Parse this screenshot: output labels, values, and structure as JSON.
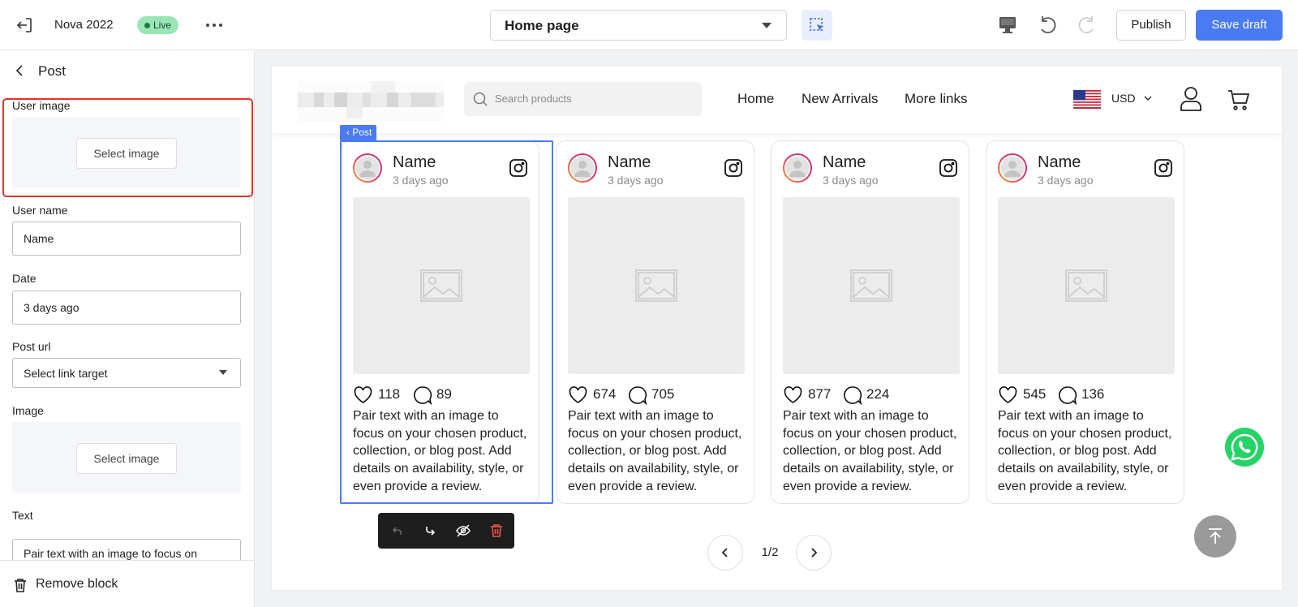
{
  "topbar": {
    "store_name": "Nova 2022",
    "status_badge": "Live",
    "page_select": "Home page",
    "publish_label": "Publish",
    "save_label": "Save draft"
  },
  "sidebar": {
    "title": "Post",
    "user_image_label": "User image",
    "select_image_label": "Select image",
    "user_name_label": "User name",
    "user_name_value": "Name",
    "date_label": "Date",
    "date_value": "3 days ago",
    "post_url_label": "Post url",
    "post_url_value": "Select link target",
    "image_label": "Image",
    "text_label": "Text",
    "text_value": "Pair text with an image to focus on",
    "remove_label": "Remove block"
  },
  "preview": {
    "search_placeholder": "Search products",
    "nav": [
      "Home",
      "New Arrivals",
      "More links"
    ],
    "currency": "USD",
    "post_tag": "Post",
    "pagination": "1/2",
    "posts": [
      {
        "name": "Name",
        "date": "3 days ago",
        "likes": "118",
        "comments": "89",
        "text": "Pair text with an image to focus on your chosen product, collection, or blog post. Add details on availability, style, or even provide a review."
      },
      {
        "name": "Name",
        "date": "3 days ago",
        "likes": "674",
        "comments": "705",
        "text": "Pair text with an image to focus on your chosen product, collection, or blog post. Add details on availability, style, or even provide a review."
      },
      {
        "name": "Name",
        "date": "3 days ago",
        "likes": "877",
        "comments": "224",
        "text": "Pair text with an image to focus on your chosen product, collection, or blog post. Add details on availability, style, or even provide a review."
      },
      {
        "name": "Name",
        "date": "3 days ago",
        "likes": "545",
        "comments": "136",
        "text": "Pair text with an image to focus on your chosen product, collection, or blog post. Add details on availability, style, or even provide a review."
      }
    ]
  },
  "colors": {
    "accent": "#4a7bf2",
    "highlight_border": "#e0342c",
    "live_badge": "#9be6b6",
    "whatsapp": "#25d366"
  },
  "icons": [
    "exit-icon",
    "more-icon",
    "select-tool-icon",
    "desktop-icon",
    "undo-icon",
    "redo-icon",
    "back-icon",
    "trash-icon",
    "search-icon",
    "us-flag-icon",
    "chevron-down-icon",
    "user-icon",
    "cart-icon",
    "avatar-icon",
    "instagram-icon",
    "image-placeholder-icon",
    "heart-icon",
    "comment-icon",
    "move-up-icon",
    "move-down-icon",
    "hide-icon",
    "delete-icon",
    "chevron-left-icon",
    "chevron-right-icon",
    "whatsapp-icon",
    "arrow-up-icon"
  ]
}
